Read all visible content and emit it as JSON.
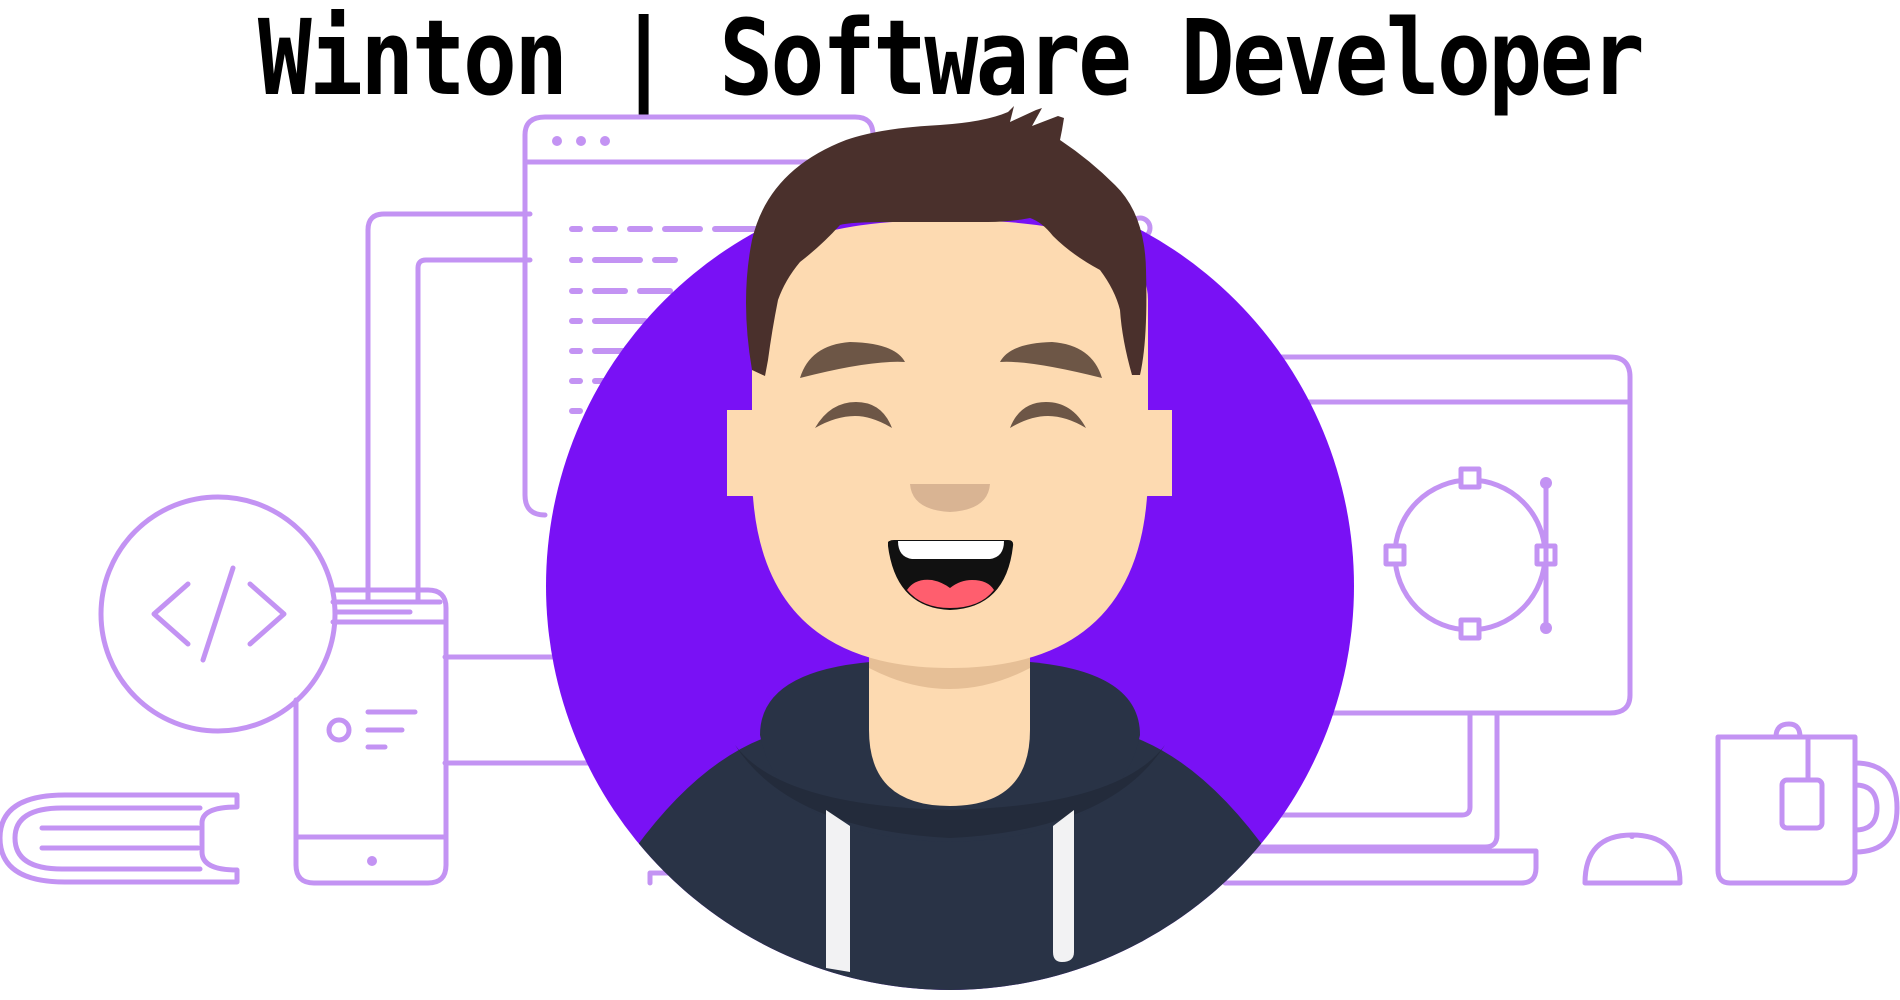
{
  "header": {
    "title": "Winton | Software Developer"
  },
  "illustration": {
    "avatar_circle_color": "#7911F5",
    "line_art_color": "#C393F3",
    "hoodie_color": "#293346",
    "skin_color": "#FDDAB1",
    "hair_color": "#4A302C",
    "icons": [
      "browser-window-icon",
      "code-brackets-icon",
      "smartphone-icon",
      "books-stack-icon",
      "monitor-icon",
      "vector-circle-icon",
      "coffee-mug-icon",
      "desk-lamp-icon",
      "developer-avatar"
    ]
  }
}
